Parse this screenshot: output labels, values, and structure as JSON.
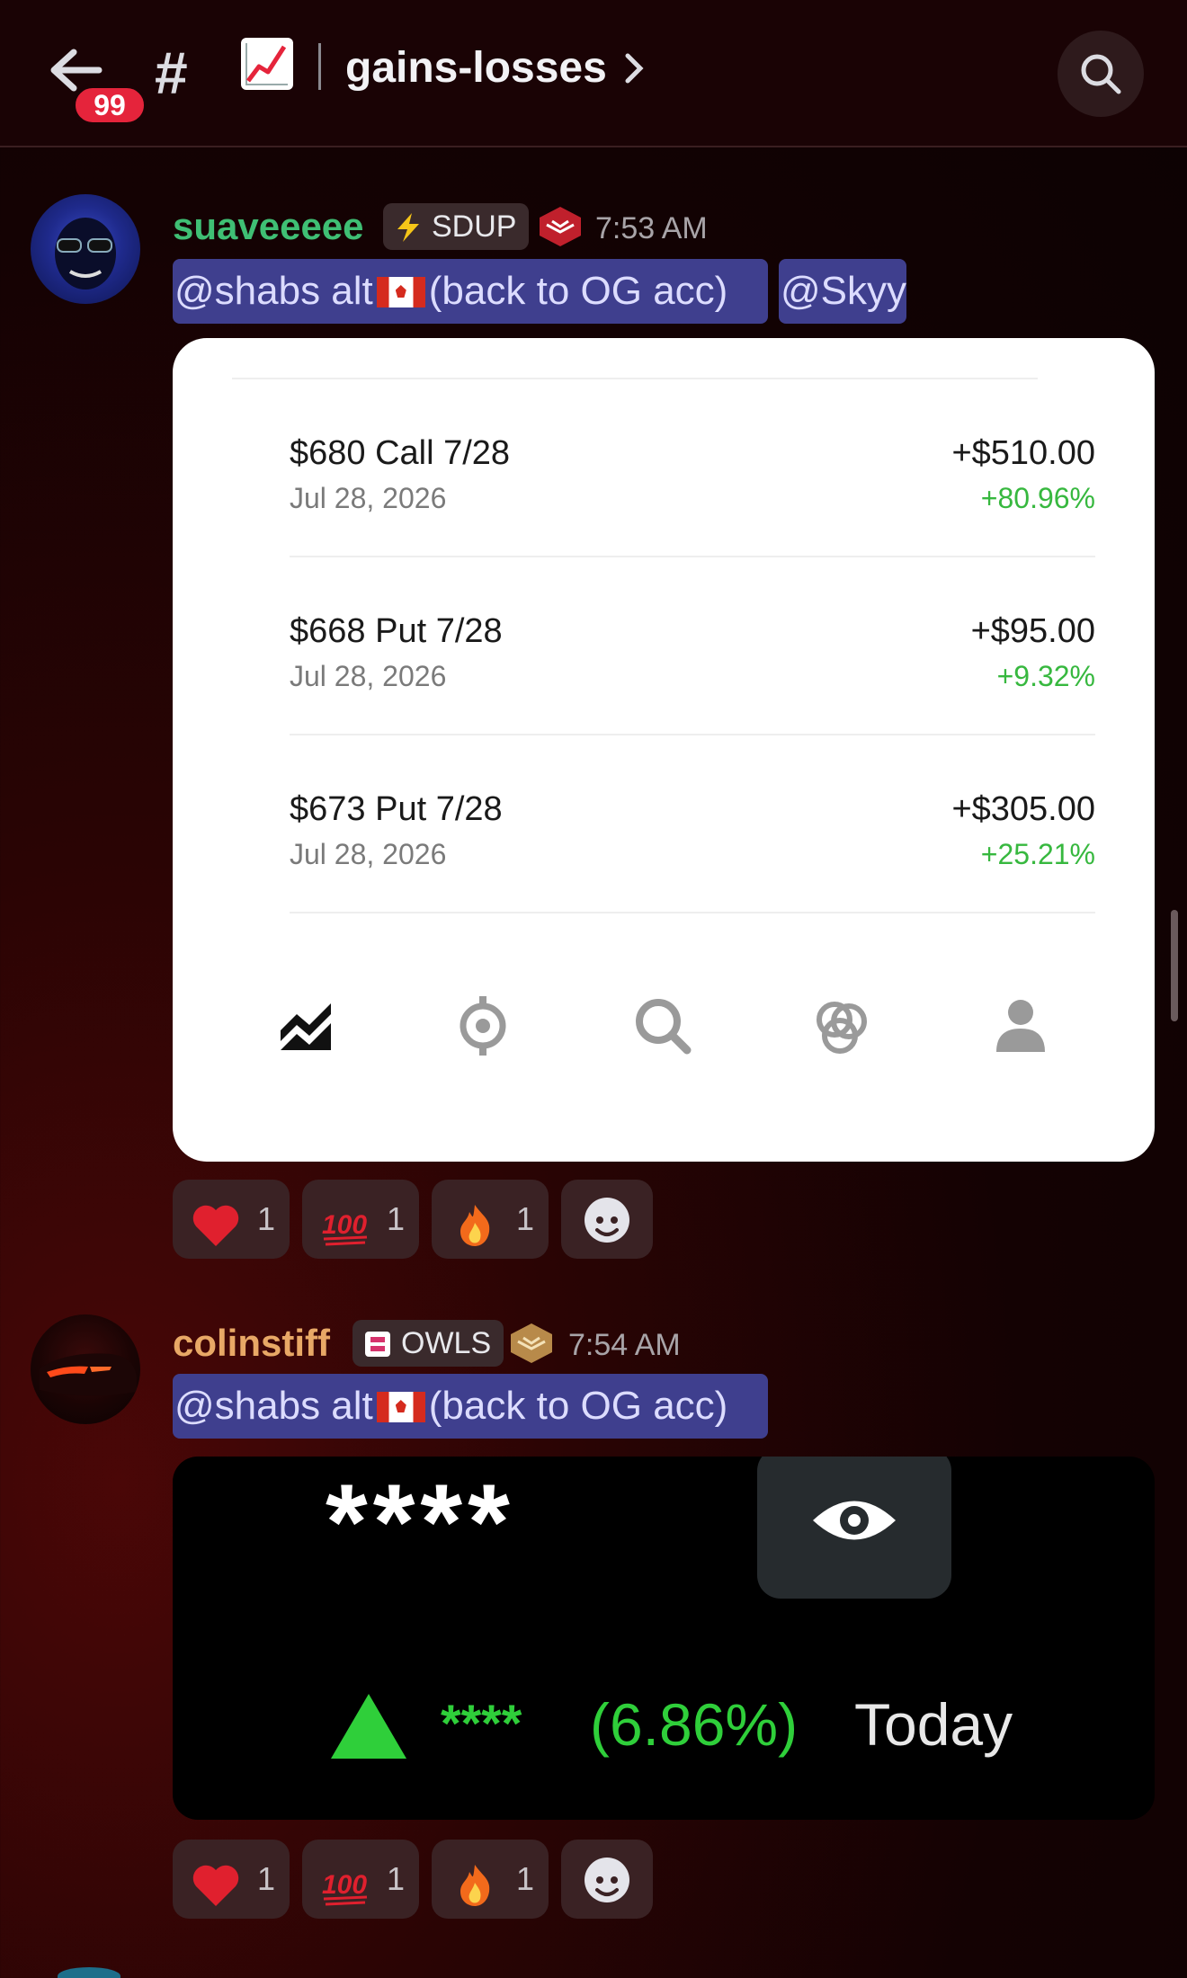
{
  "header": {
    "unread_count": "99",
    "hash": "#",
    "channel_emoji": "chart-increasing",
    "channel_name": "gains-losses"
  },
  "messages": [
    {
      "username": "suaveeeee",
      "username_color": "#3fbf74",
      "tag": "SDUP",
      "tag_icon": "lightning-icon",
      "timestamp": "7:53 AM",
      "mentions": [
        "@shabs alt",
        "(back to OG acc)",
        "@Skyy"
      ],
      "card": {
        "positions": [
          {
            "name": "$680 Call 7/28",
            "date": "Jul 28, 2026",
            "amount": "+$510.00",
            "pct": "+80.96%"
          },
          {
            "name": "$668 Put 7/28",
            "date": "Jul 28, 2026",
            "amount": "+$95.00",
            "pct": "+9.32%"
          },
          {
            "name": "$673 Put 7/28",
            "date": "Jul 28, 2026",
            "amount": "+$305.00",
            "pct": "+25.21%"
          }
        ],
        "nav": [
          "chart-icon",
          "crypto-icon",
          "search-icon",
          "rings-icon",
          "profile-icon"
        ]
      },
      "reactions": [
        {
          "emoji": "heart",
          "count": "1"
        },
        {
          "emoji": "hundred",
          "count": "1"
        },
        {
          "emoji": "fire",
          "count": "1"
        }
      ]
    },
    {
      "username": "colinstiff",
      "username_color": "#e8a866",
      "tag": "OWLS",
      "tag_icon": "owls-icon",
      "timestamp": "7:54 AM",
      "mentions": [
        "@shabs alt",
        "(back to OG acc)"
      ],
      "image": {
        "balance_masked": "****",
        "gain_masked": "****",
        "gain_pct": "(6.86%)",
        "period": "Today"
      },
      "reactions": [
        {
          "emoji": "heart",
          "count": "1"
        },
        {
          "emoji": "hundred",
          "count": "1"
        },
        {
          "emoji": "fire",
          "count": "1"
        }
      ]
    }
  ]
}
